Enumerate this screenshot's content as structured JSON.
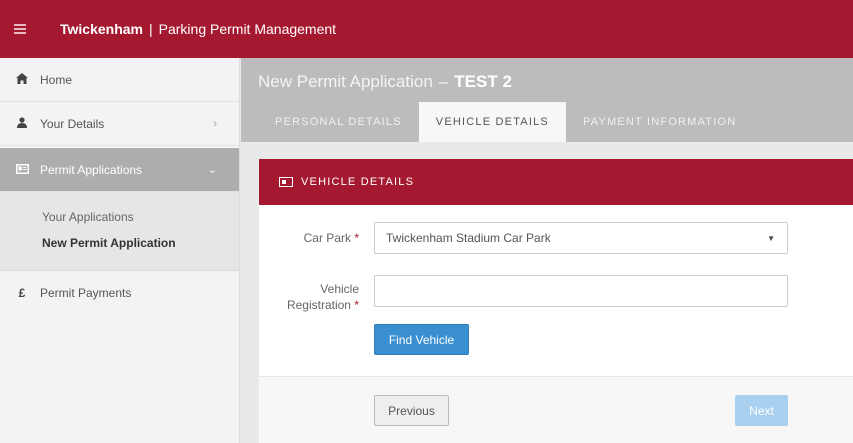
{
  "topbar": {
    "brand_bold": "Twickenham",
    "separator": "|",
    "brand_rest": "Parking Permit Management"
  },
  "sidebar": {
    "items": [
      {
        "label": "Home",
        "icon": "home-icon"
      },
      {
        "label": "Your Details",
        "icon": "user-icon",
        "chevron": "›"
      },
      {
        "label": "Permit Applications",
        "icon": "id-card-icon",
        "chevron": "⌄"
      },
      {
        "label": "Permit Payments",
        "icon": "pound-icon",
        "icon_glyph": "£"
      }
    ],
    "submenu": [
      {
        "label": "Your Applications"
      },
      {
        "label": "New Permit Application"
      }
    ]
  },
  "header": {
    "title": "New Permit Application",
    "dash": "–",
    "title_bold": "TEST 2",
    "tabs": [
      {
        "label": "PERSONAL DETAILS"
      },
      {
        "label": "VEHICLE DETAILS",
        "active": true
      },
      {
        "label": "PAYMENT INFORMATION"
      }
    ]
  },
  "panel": {
    "heading": "VEHICLE DETAILS",
    "car_park_label": "Car Park",
    "car_park_value": "Twickenham Stadium Car Park",
    "vehicle_label_1": "Vehicle",
    "vehicle_label_2": "Registration",
    "required_mark": "*",
    "vehicle_value": "",
    "find_button": "Find Vehicle",
    "previous_button": "Previous",
    "next_button": "Next"
  },
  "colors": {
    "brand": "#a51930",
    "header_grey": "#bcbcbc",
    "primary_button": "#3a8fd0",
    "disabled_button": "#a9d0ee"
  }
}
